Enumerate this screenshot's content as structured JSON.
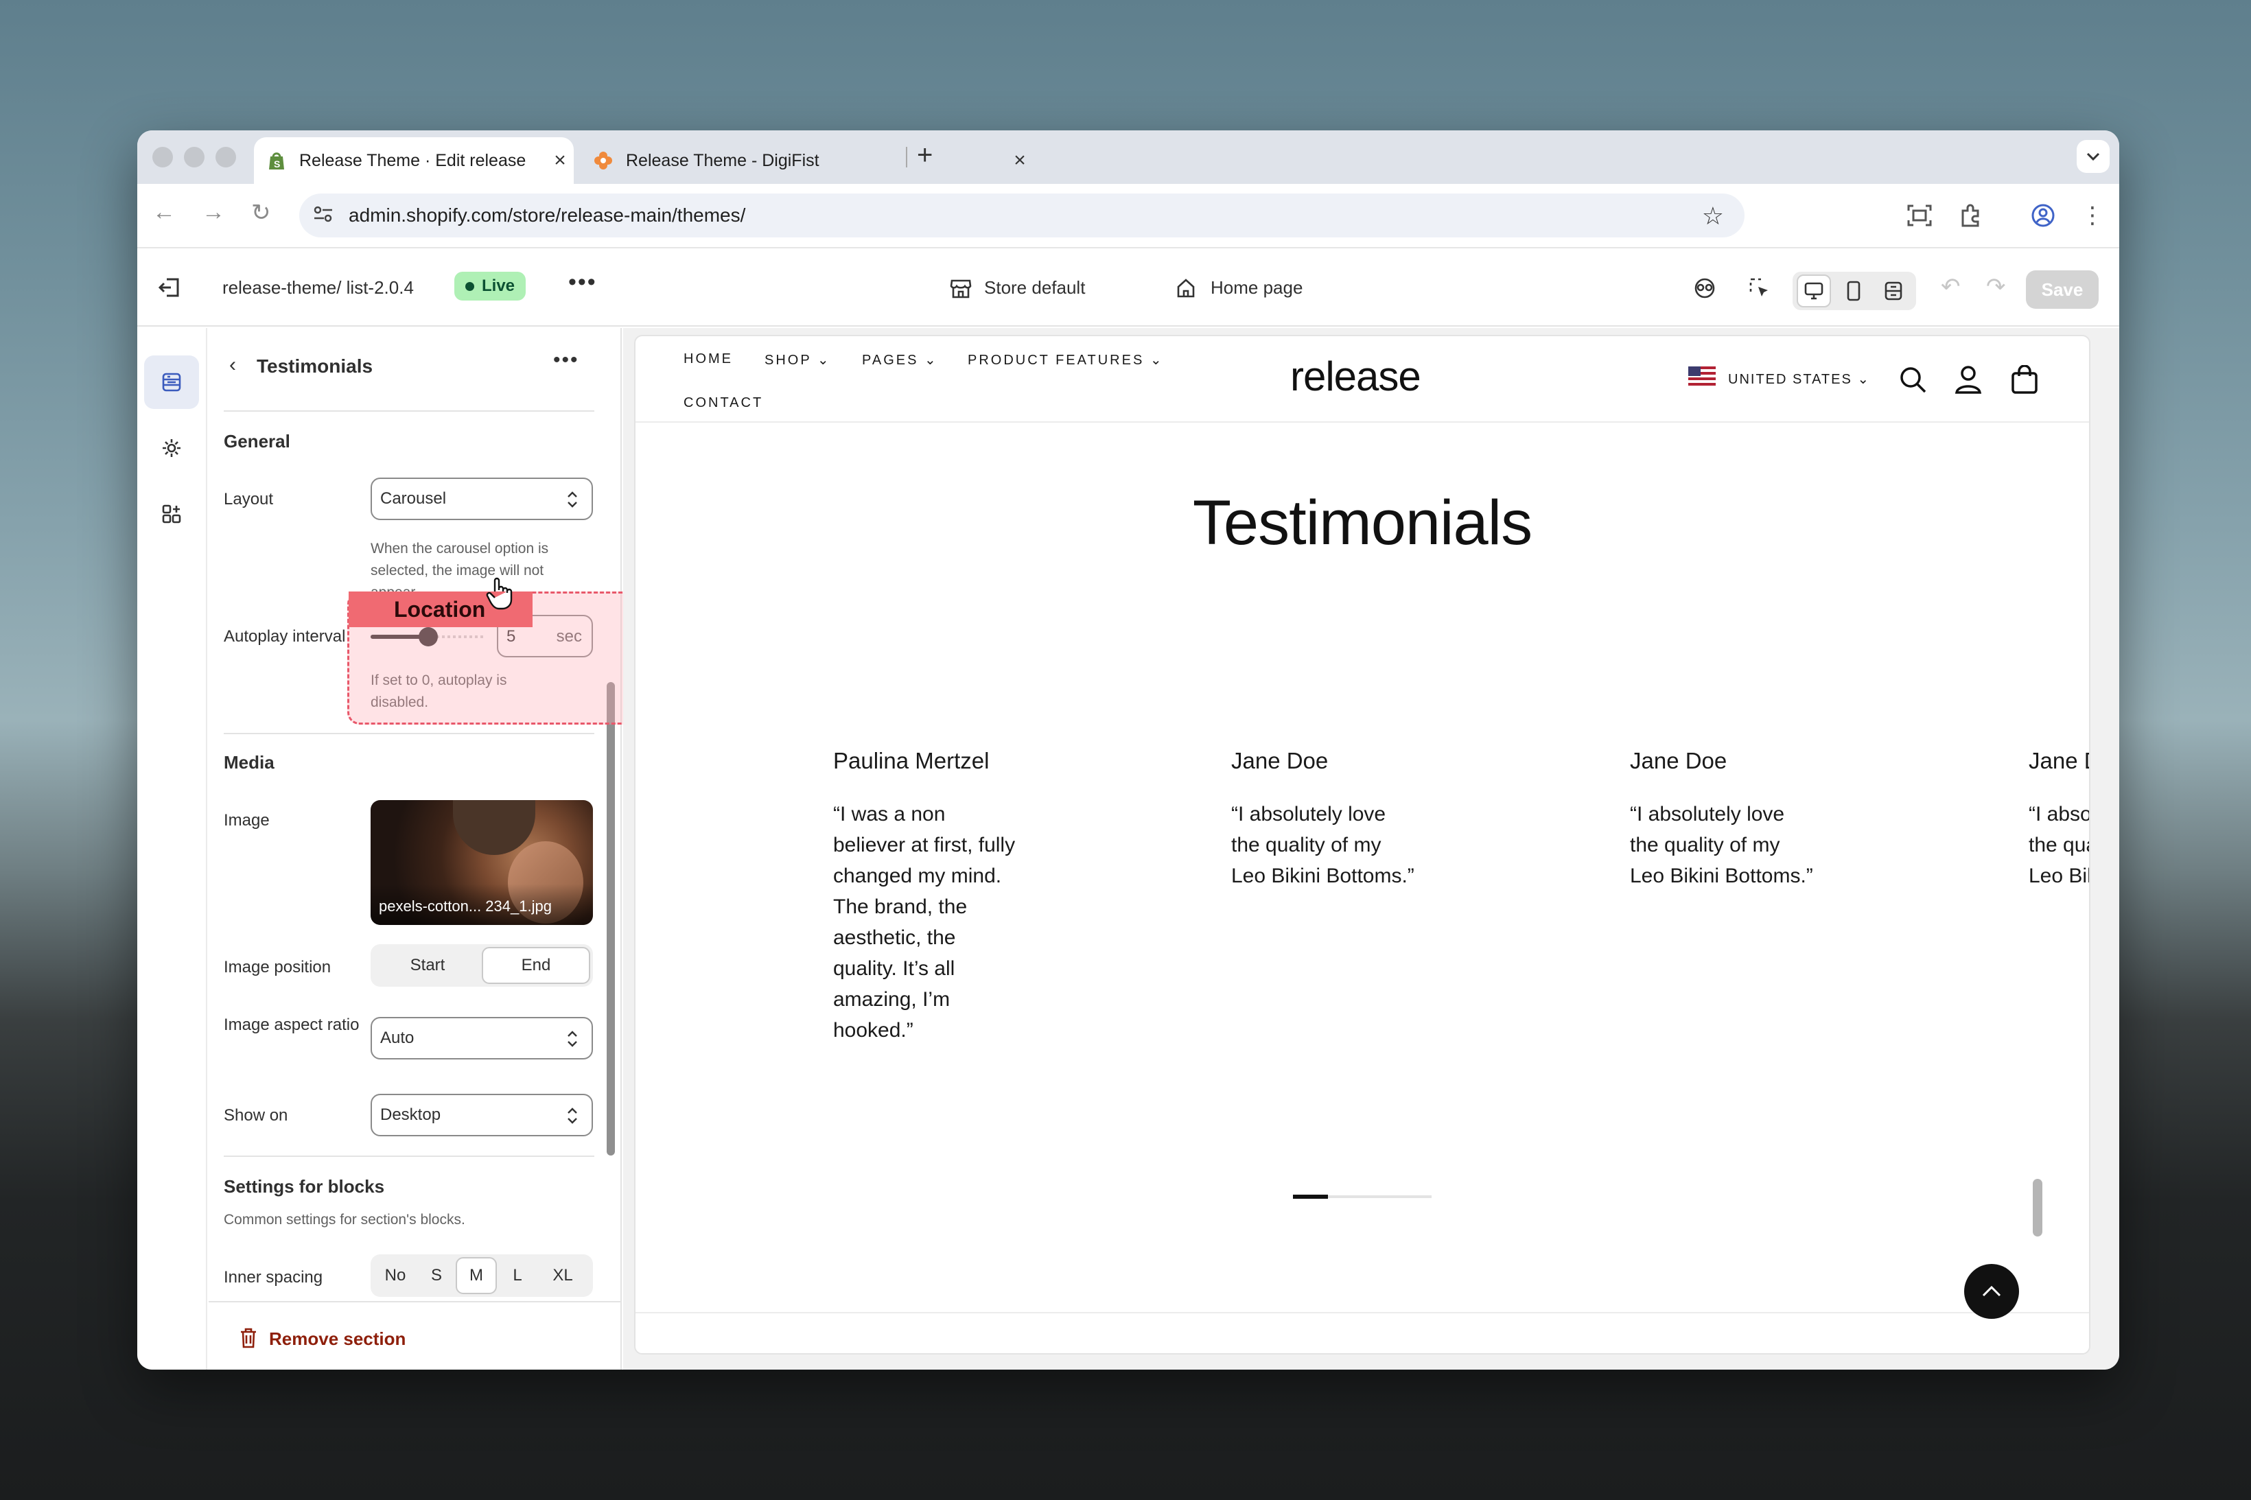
{
  "browser": {
    "tabs": [
      {
        "title": "Release Theme · Edit release",
        "active": true
      },
      {
        "title": "Release Theme - DigiFist",
        "active": false
      }
    ],
    "url": "admin.shopify.com/store/release-main/themes/"
  },
  "editor": {
    "theme_name": "release-theme/ list-2.0.4",
    "status": "Live",
    "template": "Store default",
    "page": "Home page",
    "save_label": "Save"
  },
  "panel": {
    "title": "Testimonials",
    "general_heading": "General",
    "layout_label": "Layout",
    "layout_value": "Carousel",
    "layout_help": "When the carousel option is selected, the image will not appear.",
    "autoplay_label": "Autoplay interval",
    "autoplay_value": "5",
    "autoplay_unit": "sec",
    "autoplay_fraction": 0.5,
    "autoplay_help": "If set to 0, autoplay is disabled.",
    "media_heading": "Media",
    "image_label": "Image",
    "image_file": "pexels-cotton... 234_1.jpg",
    "image_position_label": "Image position",
    "image_position_options": [
      "Start",
      "End"
    ],
    "image_position_selected": "End",
    "aspect_label": "Image aspect ratio",
    "aspect_value": "Auto",
    "show_on_label": "Show on",
    "show_on_value": "Desktop",
    "blocks_heading": "Settings for blocks",
    "blocks_help": "Common settings for section's blocks.",
    "spacing_label": "Inner spacing",
    "spacing_options": [
      "No",
      "S",
      "M",
      "L",
      "XL"
    ],
    "spacing_selected": "M",
    "remove_label": "Remove section"
  },
  "overlay": {
    "label": "Location"
  },
  "site": {
    "nav": [
      "HOME",
      "SHOP",
      "PAGES",
      "PRODUCT FEATURES",
      "CONTACT"
    ],
    "logo": "release",
    "country": "UNITED STATES",
    "heading": "Testimonials",
    "testimonials": [
      {
        "name": "Paulina Mertzel",
        "quote": "“I was a non believer at first, fully changed my mind. The brand, the aesthetic, the quality. It’s all amazing, I’m hooked.”"
      },
      {
        "name": "Jane Doe",
        "quote": "“I absolutely love the quality of my Leo Bikini Bottoms.”"
      },
      {
        "name": "Jane Doe",
        "quote": "“I absolutely love the quality of my Leo Bikini Bottoms.”"
      },
      {
        "name": "Jane D",
        "quote": "“I absolutely love the quality of my Leo Bikini Bottoms.”"
      }
    ],
    "carousel_progress": 0.25
  },
  "colors": {
    "live_bg": "#aff0b5",
    "remove_red": "#8e1f0b",
    "overlay_border": "#e8586a"
  }
}
